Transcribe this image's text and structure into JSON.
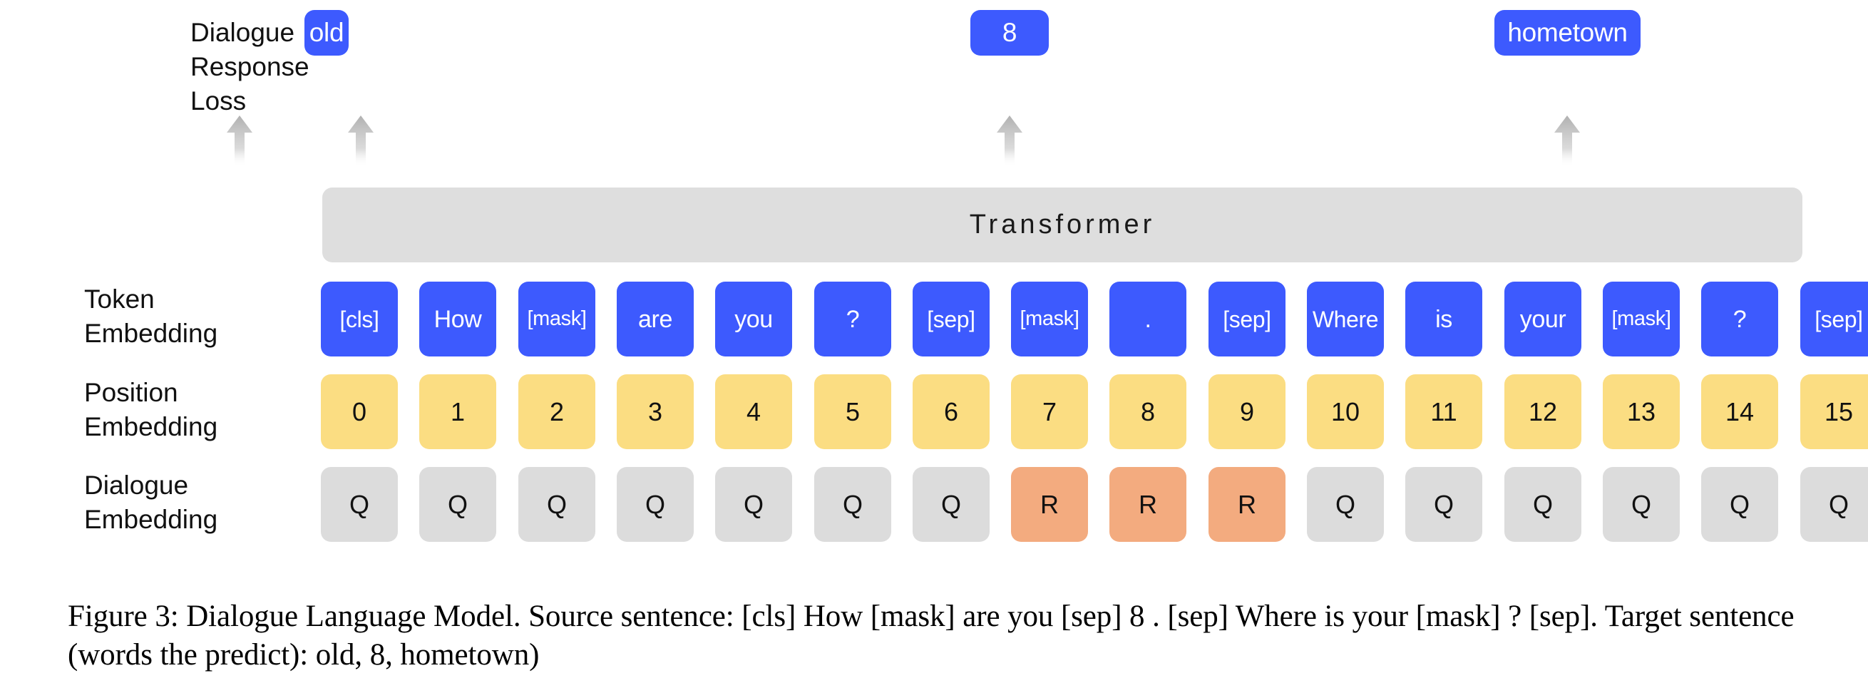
{
  "figure": {
    "loss_label": "Dialogue\nResponse Loss",
    "transformer_label": "Transformer",
    "row_labels": {
      "token": "Token\nEmbedding",
      "position": "Position\nEmbedding",
      "dialogue": "Dialogue\nEmbedding"
    },
    "outputs": [
      {
        "label": "old"
      },
      {
        "label": "8"
      },
      {
        "label": "hometown"
      }
    ],
    "arrows": [
      {
        "name": "arrow-loss"
      },
      {
        "name": "arrow-old"
      },
      {
        "name": "arrow-8"
      },
      {
        "name": "arrow-hometown"
      }
    ],
    "token_embedding": [
      "[cls]",
      "How",
      "[mask]",
      "are",
      "you",
      "?",
      "[sep]",
      "[mask]",
      ".",
      "[sep]",
      "Where",
      "is",
      "your",
      "[mask]",
      "?",
      "[sep]"
    ],
    "position_embedding": [
      "0",
      "1",
      "2",
      "3",
      "4",
      "5",
      "6",
      "7",
      "8",
      "9",
      "10",
      "11",
      "12",
      "13",
      "14",
      "15"
    ],
    "dialogue_embedding": [
      "Q",
      "Q",
      "Q",
      "Q",
      "Q",
      "Q",
      "Q",
      "R",
      "R",
      "R",
      "Q",
      "Q",
      "Q",
      "Q",
      "Q",
      "Q"
    ],
    "dialogue_embedding_roles": [
      "q",
      "q",
      "q",
      "q",
      "q",
      "q",
      "q",
      "r",
      "r",
      "r",
      "q",
      "q",
      "q",
      "q",
      "q",
      "q"
    ],
    "colors": {
      "token_box": "#3d5afe",
      "position_box": "#fbdd82",
      "dialogue_q_box": "#dcdcdc",
      "dialogue_r_box": "#f3ab7f",
      "transformer_bar": "#dedede",
      "arrow": "#b4b4b4",
      "text_on_blue": "#ffffff",
      "text_dark": "#111111"
    },
    "caption": "Figure 3: Dialogue Language Model. Source sentence: [cls] How [mask] are you  [sep] 8 . [sep] Where is your [mask] ? [sep]. Target sentence (words the predict): old, 8, hometown)"
  }
}
